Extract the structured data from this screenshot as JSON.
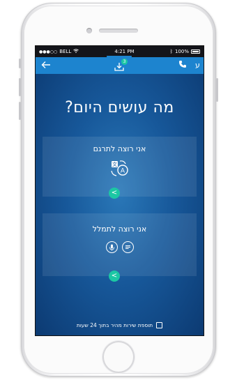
{
  "status_bar": {
    "carrier": "BELL",
    "time": "4:21 PM",
    "battery": "100%"
  },
  "app_bar": {
    "back_icon": "arrow-left-icon",
    "downloads_icon": "download-tray-icon",
    "downloads_badge": "3",
    "phone_icon": "phone-icon",
    "language_toggle": "ע"
  },
  "main": {
    "title": "מה עושים היום?",
    "cards": [
      {
        "label": "אני רוצה לתרגם",
        "icons": [
          "translate-icon"
        ],
        "go_label": "<"
      },
      {
        "label": "אני רוצה לתמלל",
        "icons": [
          "microphone-icon",
          "speech-bubble-icon"
        ],
        "go_label": "<"
      }
    ],
    "express_service_label": "תוספת שירות מהיר בתוך 24 שעות"
  },
  "colors": {
    "app_bar": "#1d84cf",
    "background": "#0e3f78",
    "accent": "#1cc7a4"
  }
}
